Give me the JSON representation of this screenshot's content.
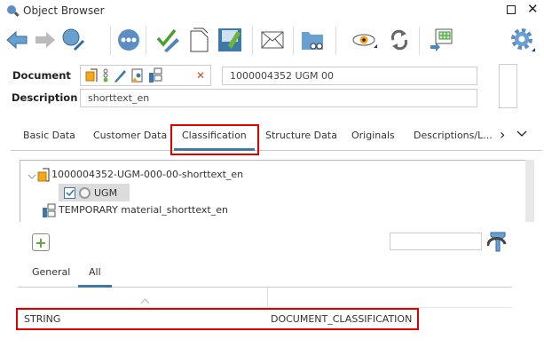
{
  "window": {
    "title": "Object Browser"
  },
  "toolbar": {
    "icons": [
      "back-arrow",
      "forward-arrow",
      "search-edit",
      "more",
      "check-edit",
      "new-document",
      "save",
      "email",
      "folder-search",
      "display",
      "refresh",
      "export-table",
      "settings"
    ]
  },
  "document": {
    "label": "Document",
    "value": "1000004352  UGM  00",
    "description_label": "Description",
    "description_value": "shorttext_en"
  },
  "tabs": [
    {
      "label": "Basic Data"
    },
    {
      "label": "Customer Data"
    },
    {
      "label": "Classification",
      "active": true
    },
    {
      "label": "Structure Data"
    },
    {
      "label": "Originals"
    },
    {
      "label": "Descriptions/L..."
    }
  ],
  "tree": {
    "items": [
      {
        "label": "1000004352-UGM-000-00-shorttext_en"
      },
      {
        "label": "UGM",
        "checked": true
      },
      {
        "label": "TEMPORARY material_shorttext_en"
      }
    ]
  },
  "search": {
    "value": ""
  },
  "subtabs": [
    {
      "label": "General"
    },
    {
      "label": "All",
      "active": true
    }
  ],
  "table": {
    "rows": [
      {
        "col1": "STRING",
        "col2": "DOCUMENT_CLASSIFICATION"
      }
    ]
  },
  "colors": {
    "accent": "#3d78a8",
    "highlight": "#e00000"
  }
}
